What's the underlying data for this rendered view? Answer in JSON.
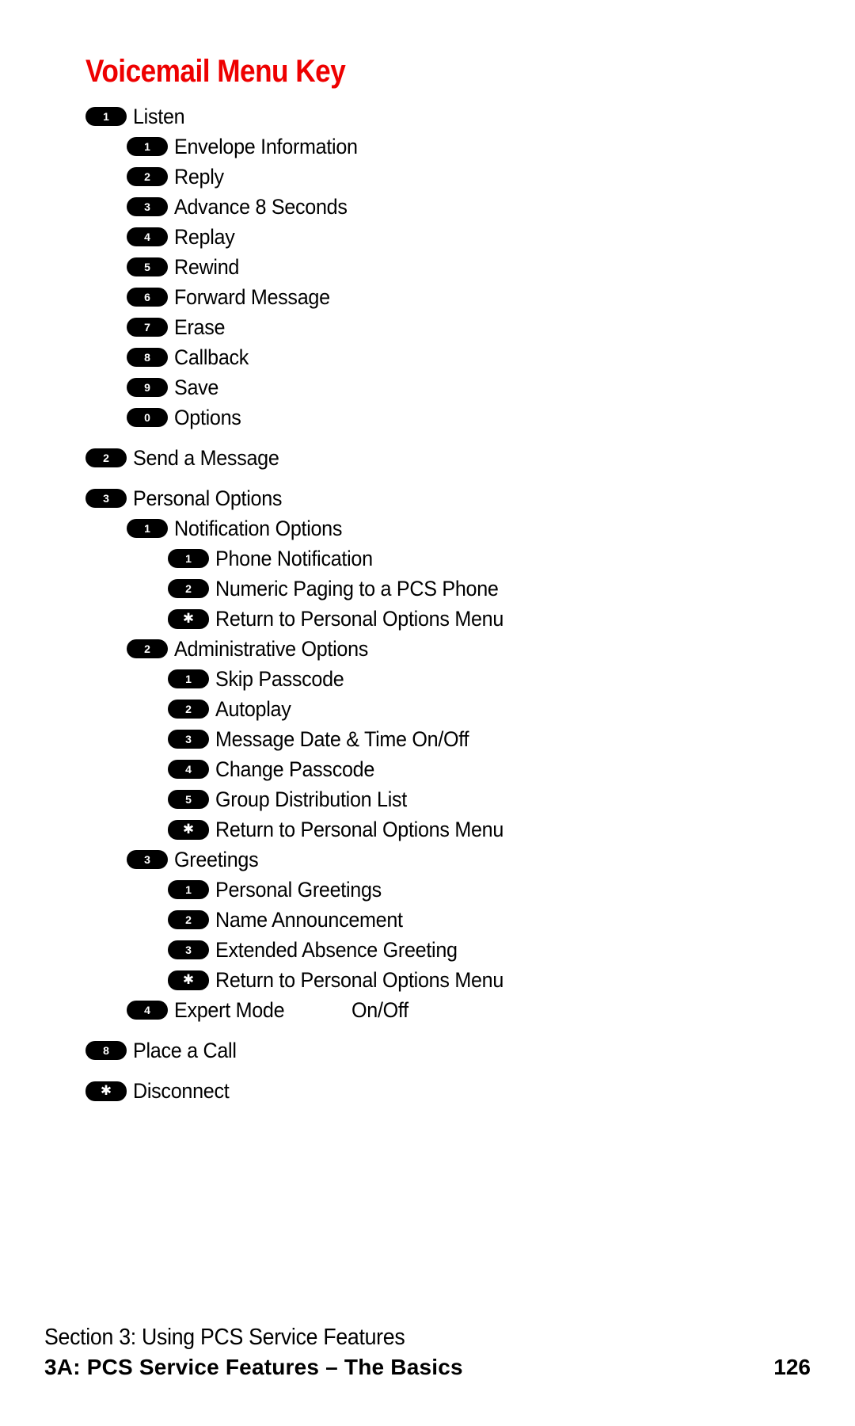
{
  "document": {
    "title": "Voicemail Menu Key",
    "title_color": "#ee0000"
  },
  "menu": {
    "items": [
      {
        "key": "1",
        "label": "Listen",
        "level": 1,
        "gap_before": false
      },
      {
        "key": "1",
        "label": "Envelope Information",
        "level": 2,
        "gap_before": false
      },
      {
        "key": "2",
        "label": "Reply",
        "level": 2,
        "gap_before": false
      },
      {
        "key": "3",
        "label": "Advance 8 Seconds",
        "level": 2,
        "gap_before": false
      },
      {
        "key": "4",
        "label": "Replay",
        "level": 2,
        "gap_before": false
      },
      {
        "key": "5",
        "label": "Rewind",
        "level": 2,
        "gap_before": false
      },
      {
        "key": "6",
        "label": "Forward Message",
        "level": 2,
        "gap_before": false
      },
      {
        "key": "7",
        "label": "Erase",
        "level": 2,
        "gap_before": false
      },
      {
        "key": "8",
        "label": "Callback",
        "level": 2,
        "gap_before": false
      },
      {
        "key": "9",
        "label": "Save",
        "level": 2,
        "gap_before": false
      },
      {
        "key": "0",
        "label": "Options",
        "level": 2,
        "gap_before": false
      },
      {
        "key": "2",
        "label": "Send a Message",
        "level": 1,
        "gap_before": true
      },
      {
        "key": "3",
        "label": "Personal Options",
        "level": 1,
        "gap_before": true
      },
      {
        "key": "1",
        "label": "Notification Options",
        "level": 2,
        "gap_before": false
      },
      {
        "key": "1",
        "label": "Phone Notification",
        "level": 3,
        "gap_before": false
      },
      {
        "key": "2",
        "label": "Numeric Paging to a PCS Phone",
        "level": 3,
        "gap_before": false
      },
      {
        "key": "*",
        "label": "Return to Personal Options Menu",
        "level": 3,
        "gap_before": false
      },
      {
        "key": "2",
        "label": "Administrative Options",
        "level": 2,
        "gap_before": false
      },
      {
        "key": "1",
        "label": "Skip Passcode",
        "level": 3,
        "gap_before": false
      },
      {
        "key": "2",
        "label": "Autoplay",
        "level": 3,
        "gap_before": false
      },
      {
        "key": "3",
        "label": "Message Date & Time On/Off",
        "level": 3,
        "gap_before": false
      },
      {
        "key": "4",
        "label": "Change Passcode",
        "level": 3,
        "gap_before": false
      },
      {
        "key": "5",
        "label": "Group Distribution List",
        "level": 3,
        "gap_before": false
      },
      {
        "key": "*",
        "label": "Return to Personal Options Menu",
        "level": 3,
        "gap_before": false
      },
      {
        "key": "3",
        "label": "Greetings",
        "level": 2,
        "gap_before": false
      },
      {
        "key": "1",
        "label": "Personal Greetings",
        "level": 3,
        "gap_before": false
      },
      {
        "key": "2",
        "label": "Name Announcement",
        "level": 3,
        "gap_before": false
      },
      {
        "key": "3",
        "label": "Extended Absence Greeting",
        "level": 3,
        "gap_before": false
      },
      {
        "key": "*",
        "label": "Return to Personal Options Menu",
        "level": 3,
        "gap_before": false
      },
      {
        "key": "4",
        "label": "Expert Mode",
        "extra": "On/Off",
        "level": 2,
        "gap_before": false
      },
      {
        "key": "8",
        "label": "Place a Call",
        "level": 1,
        "gap_before": true
      },
      {
        "key": "*",
        "label": "Disconnect",
        "level": 1,
        "gap_before": true
      }
    ]
  },
  "footer": {
    "section": "Section 3: Using PCS Service Features",
    "chapter": "3A: PCS Service Features – The Basics",
    "page_number": "126"
  }
}
